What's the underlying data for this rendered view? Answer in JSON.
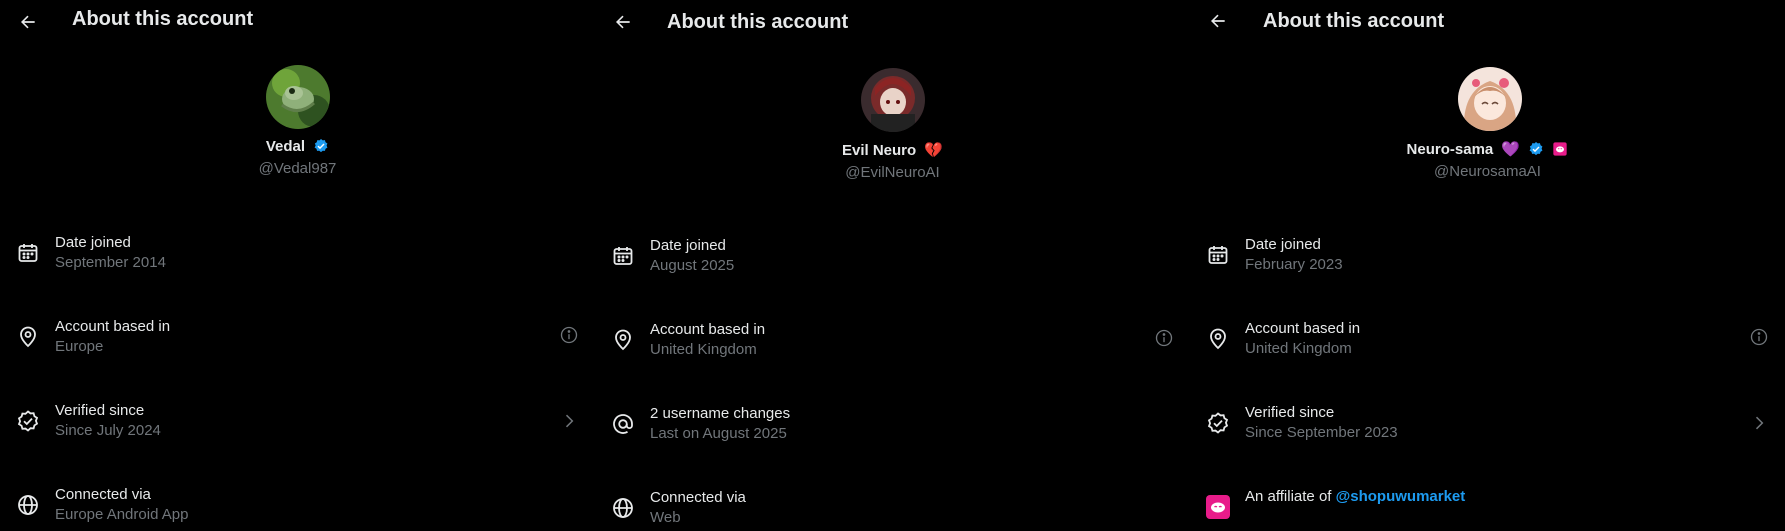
{
  "panels": [
    {
      "title": "About this account",
      "name": "Vedal",
      "handle": "@Vedal987",
      "rows": [
        {
          "label": "Date joined",
          "value": "September 2014",
          "icon": "calendar-icon"
        },
        {
          "label": "Account based in",
          "value": "Europe",
          "icon": "location-pin-icon",
          "trailing": "info-icon"
        },
        {
          "label": "Verified since",
          "value": "Since July 2024",
          "icon": "verified-check-icon",
          "trailing": "chevron-right-icon"
        },
        {
          "label": "Connected via",
          "value": "Europe Android App",
          "icon": "globe-icon"
        }
      ]
    },
    {
      "title": "About this account",
      "name": "Evil Neuro",
      "emoji": "💔",
      "handle": "@EvilNeuroAI",
      "rows": [
        {
          "label": "Date joined",
          "value": "August 2025",
          "icon": "calendar-icon"
        },
        {
          "label": "Account based in",
          "value": "United Kingdom",
          "icon": "location-pin-icon",
          "trailing": "info-icon"
        },
        {
          "label": "2 username changes",
          "value": "Last on August 2025",
          "icon": "at-sign-icon"
        },
        {
          "label": "Connected via",
          "value": "Web",
          "icon": "globe-icon"
        }
      ]
    },
    {
      "title": "About this account",
      "name": "Neuro-sama",
      "emoji": "💜",
      "handle": "@NeurosamaAI",
      "rows": [
        {
          "label": "Date joined",
          "value": "February 2023",
          "icon": "calendar-icon"
        },
        {
          "label": "Account based in",
          "value": "United Kingdom",
          "icon": "location-pin-icon",
          "trailing": "info-icon"
        },
        {
          "label": "Verified since",
          "value": "Since September 2023",
          "icon": "verified-check-icon",
          "trailing": "chevron-right-icon"
        }
      ],
      "affiliate": {
        "prefix": "An affiliate of",
        "link": "@shopuwumarket"
      }
    }
  ],
  "colors": {
    "background": "#000000",
    "primary_text": "#e7e9ea",
    "secondary_text": "#71767b",
    "verified_blue": "#1d9bf0",
    "affiliate_pink": "#e81c8a"
  }
}
